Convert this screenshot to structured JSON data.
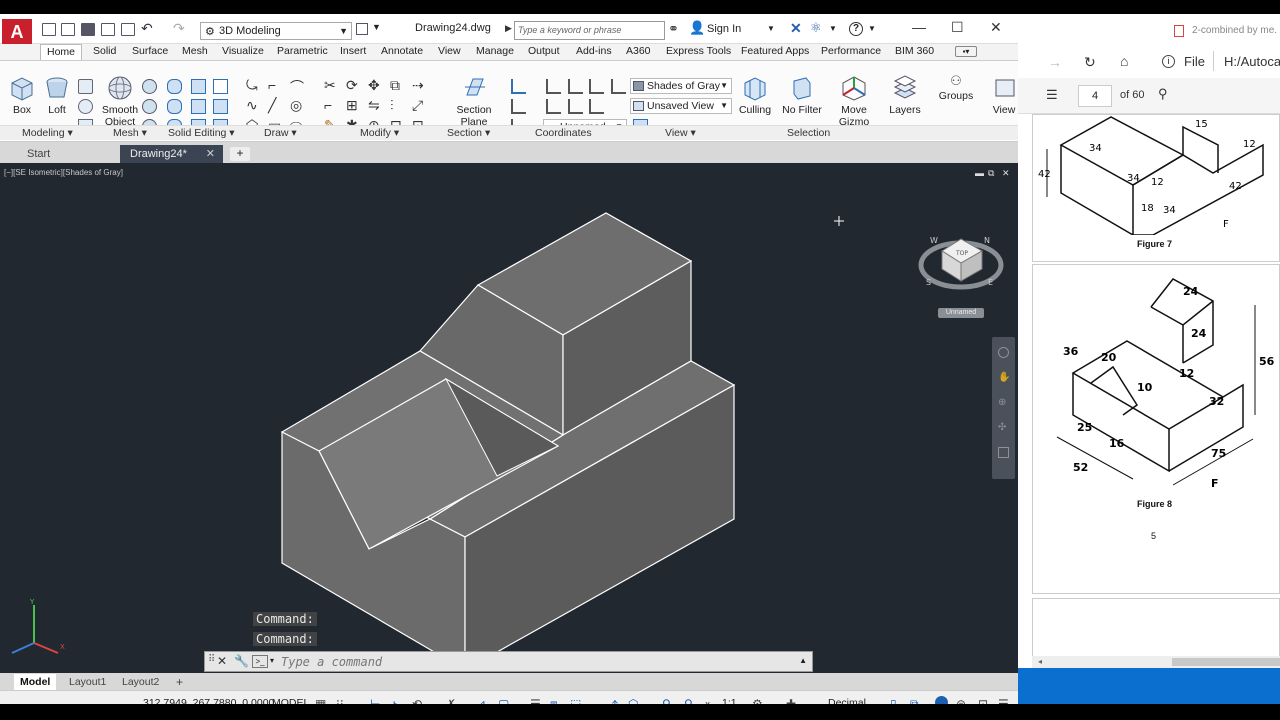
{
  "app": {
    "logo_letter": "A",
    "workspace": "3D Modeling",
    "doc_title": "Drawing24.dwg",
    "search_placeholder": "Type a keyword or phrase",
    "sign_in": "Sign In"
  },
  "ribbon_tabs": [
    "Home",
    "Solid",
    "Surface",
    "Mesh",
    "Visualize",
    "Parametric",
    "Insert",
    "Annotate",
    "View",
    "Manage",
    "Output",
    "Add-ins",
    "A360",
    "Express Tools",
    "Featured Apps",
    "Performance",
    "BIM 360"
  ],
  "ribbon": {
    "box": "Box",
    "loft": "Loft",
    "smooth_object_1": "Smooth",
    "smooth_object_2": "Object",
    "section_plane_1": "Section",
    "section_plane_2": "Plane",
    "visual_style": "Shades of Gray",
    "view": "Unsaved View",
    "ucs": "Unnamed",
    "culling": "Culling",
    "no_filter": "No Filter",
    "move_gizmo_1": "Move",
    "move_gizmo_2": "Gizmo",
    "layers": "Layers",
    "groups": "Groups",
    "view_btn": "View"
  },
  "panels": [
    "Modeling",
    "Mesh",
    "Solid Editing",
    "Draw",
    "Modify",
    "Section",
    "Coordinates",
    "View",
    "Selection"
  ],
  "doc_tabs": [
    "Start",
    "Drawing24*"
  ],
  "viewport": {
    "label": "[−][SE Isometric][Shades of Gray]",
    "viewcube_label": "Unnamed",
    "viewcube_face": "TOP",
    "compass": [
      "N",
      "E",
      "S",
      "W"
    ]
  },
  "command": {
    "history": [
      "Command:",
      "Command:"
    ],
    "placeholder": "Type a command"
  },
  "layout_tabs": [
    "Model",
    "Layout1",
    "Layout2"
  ],
  "status": {
    "coords": "312.7949, 267.7880, 0.0000",
    "model": "MODEL",
    "scale": "1:1",
    "units": "Decimal"
  },
  "pdf": {
    "tab_title": "2-combined by me.",
    "file_label": "File",
    "address": "H:/Autoca",
    "page_current": "4",
    "page_total": "of 60",
    "figure7": "Figure 7",
    "figure8": "Figure 8",
    "page_number": "5",
    "fig8_dims": [
      "24",
      "24",
      "36",
      "20",
      "10",
      "56",
      "32",
      "25",
      "16",
      "52",
      "75",
      "12",
      "F"
    ],
    "fig7_dims": [
      "42",
      "34",
      "12",
      "34",
      "18",
      "34",
      "12",
      "15",
      "42",
      "F"
    ]
  },
  "colors": {
    "accent_red": "#c8202d",
    "viewport_bg": "#212830",
    "solid_face": "#767676",
    "taskbar": "#0b6fd0"
  }
}
